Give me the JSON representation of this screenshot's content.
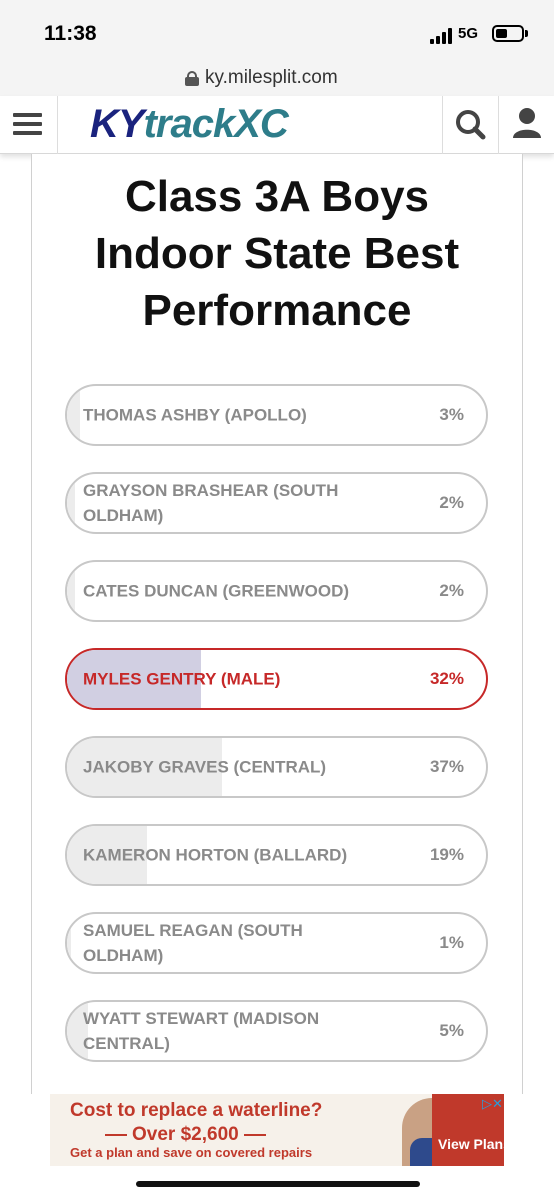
{
  "status_bar": {
    "time": "11:38",
    "network": "5G",
    "network_icon": "signal-bars-icon",
    "battery_icon": "battery-icon"
  },
  "browser": {
    "url": "ky.milesplit.com",
    "lock_icon": "lock-icon"
  },
  "header": {
    "logo_part1": "KY",
    "logo_part2": "trackXC",
    "menu_icon": "hamburger-menu-icon",
    "search_icon": "search-icon",
    "user_icon": "user-icon",
    "logo_colors": {
      "ky": "#1a237e",
      "rest": "#2e7d8a"
    }
  },
  "poll": {
    "title_line1": "Class 3A Boys",
    "title_line2": "Indoor State Best",
    "title_line3": "Performance",
    "selected_color": "#c62828",
    "options": [
      {
        "name": "THOMAS ASHBY (APOLLO)",
        "percent_label": "3%",
        "percent": 3,
        "selected": false
      },
      {
        "name": "GRAYSON BRASHEAR (SOUTH OLDHAM)",
        "percent_label": "2%",
        "percent": 2,
        "selected": false
      },
      {
        "name": "CATES DUNCAN (GREENWOOD)",
        "percent_label": "2%",
        "percent": 2,
        "selected": false
      },
      {
        "name": "MYLES GENTRY (MALE)",
        "percent_label": "32%",
        "percent": 32,
        "selected": true
      },
      {
        "name": "JAKOBY GRAVES (CENTRAL)",
        "percent_label": "37%",
        "percent": 37,
        "selected": false
      },
      {
        "name": "KAMERON HORTON (BALLARD)",
        "percent_label": "19%",
        "percent": 19,
        "selected": false
      },
      {
        "name": "SAMUEL REAGAN (SOUTH OLDHAM)",
        "percent_label": "1%",
        "percent": 1,
        "selected": false
      },
      {
        "name": "WYATT STEWART (MADISON CENTRAL)",
        "percent_label": "5%",
        "percent": 5,
        "selected": false
      }
    ]
  },
  "ad": {
    "headline": "Cost to replace a waterline?",
    "price": "Over $2,600",
    "subtext": "Get a plan and save on covered repairs",
    "cta": "View Plans",
    "choices_icon": "ad-choices-icon",
    "brand_color": "#c0392b"
  }
}
